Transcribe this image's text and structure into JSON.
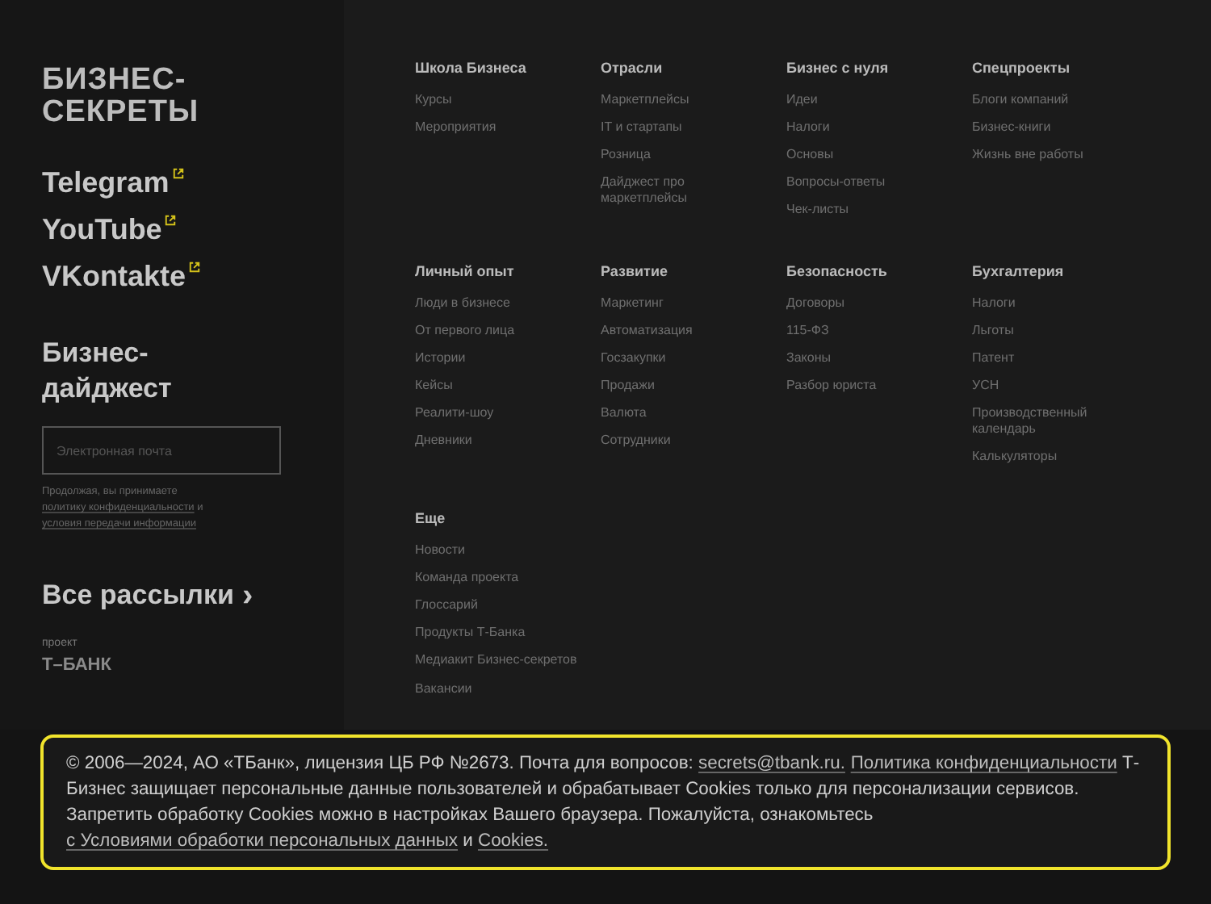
{
  "sidebar": {
    "logo": [
      "БИЗНЕС-",
      "СЕКРЕТЫ"
    ],
    "social_links": [
      {
        "label": "Telegram"
      },
      {
        "label": "YouTube"
      },
      {
        "label": "VKontakte"
      }
    ],
    "digest": {
      "title": "Бизнес-дайджест",
      "email_field": {
        "placeholder": "Электронная почта"
      },
      "consent": [
        {
          "kind": "text",
          "text": "Продолжая, вы принимаете "
        },
        {
          "kind": "link",
          "text": "политику конфиденциальности"
        },
        {
          "kind": "text",
          "text": " и "
        },
        {
          "kind": "link",
          "text": "условия передачи информации"
        }
      ]
    },
    "all_newsletters": {
      "label": "Все рассылки",
      "arrow": "›"
    },
    "project": {
      "caption": "проект",
      "brand": "Т–БАНК"
    }
  },
  "menu_sections": [
    {
      "title": "Школа Бизнеса",
      "items": [
        "Курсы",
        "Мероприятия"
      ]
    },
    {
      "title": "Отрасли",
      "items": [
        "Маркетплейсы",
        "IT и стартапы",
        "Розница",
        "Дайджест про\nмаркетплейсы"
      ]
    },
    {
      "title": "Бизнес с нуля",
      "items": [
        "Идеи",
        "Налоги",
        "Основы",
        "Вопросы-ответы",
        "Чек-листы"
      ]
    },
    {
      "title": "Спецпроекты",
      "items": [
        "Блоги компаний",
        "Бизнес-книги",
        "Жизнь вне работы"
      ]
    },
    {
      "title": "Личный опыт",
      "items": [
        "Люди в бизнесе",
        "От первого лица",
        "Истории",
        "Кейсы",
        "Реалити-шоу",
        "Дневники"
      ]
    },
    {
      "title": "Развитие",
      "items": [
        "Маркетинг",
        "Автоматизация",
        "Госзакупки",
        "Продажи",
        "Валюта",
        "Сотрудники"
      ]
    },
    {
      "title": "Безопасность",
      "items": [
        "Договоры",
        "115-ФЗ",
        "Законы",
        "Разбор юриста"
      ]
    },
    {
      "title": "Бухгалтерия",
      "items": [
        "Налоги",
        "Льготы",
        "Патент",
        "УСН",
        "Производственный\nкалендарь",
        "Калькуляторы"
      ]
    },
    {
      "title": "Еще",
      "items": [
        "Новости",
        "Команда проекта",
        "Глоссарий",
        "Продукты Т-Банка",
        "Медиакит Бизнес-секретов",
        "Вакансии"
      ]
    }
  ],
  "cookie_notice": [
    {
      "kind": "text",
      "text": "© 2006—2024, АО «ТБанк», лицензия ЦБ РФ №2673. Почта для вопросов: "
    },
    {
      "kind": "link",
      "text": "secrets@tbank.ru."
    },
    {
      "kind": "link",
      "text": "Политика конфиденциальности"
    },
    {
      "kind": "text",
      "text": " Т-Бизнес защищает персональные данные пользователей и обрабатывает Cookies только для персонализации сервисов. Запретить обработку Cookies можно в настройках Вашего браузера. Пожалуйста, ознакомьтесь "
    },
    {
      "kind": "link",
      "text": "с Условиями обработки персональных данных"
    },
    {
      "kind": "text",
      "text": " и "
    },
    {
      "kind": "link",
      "text": "Cookies."
    }
  ]
}
